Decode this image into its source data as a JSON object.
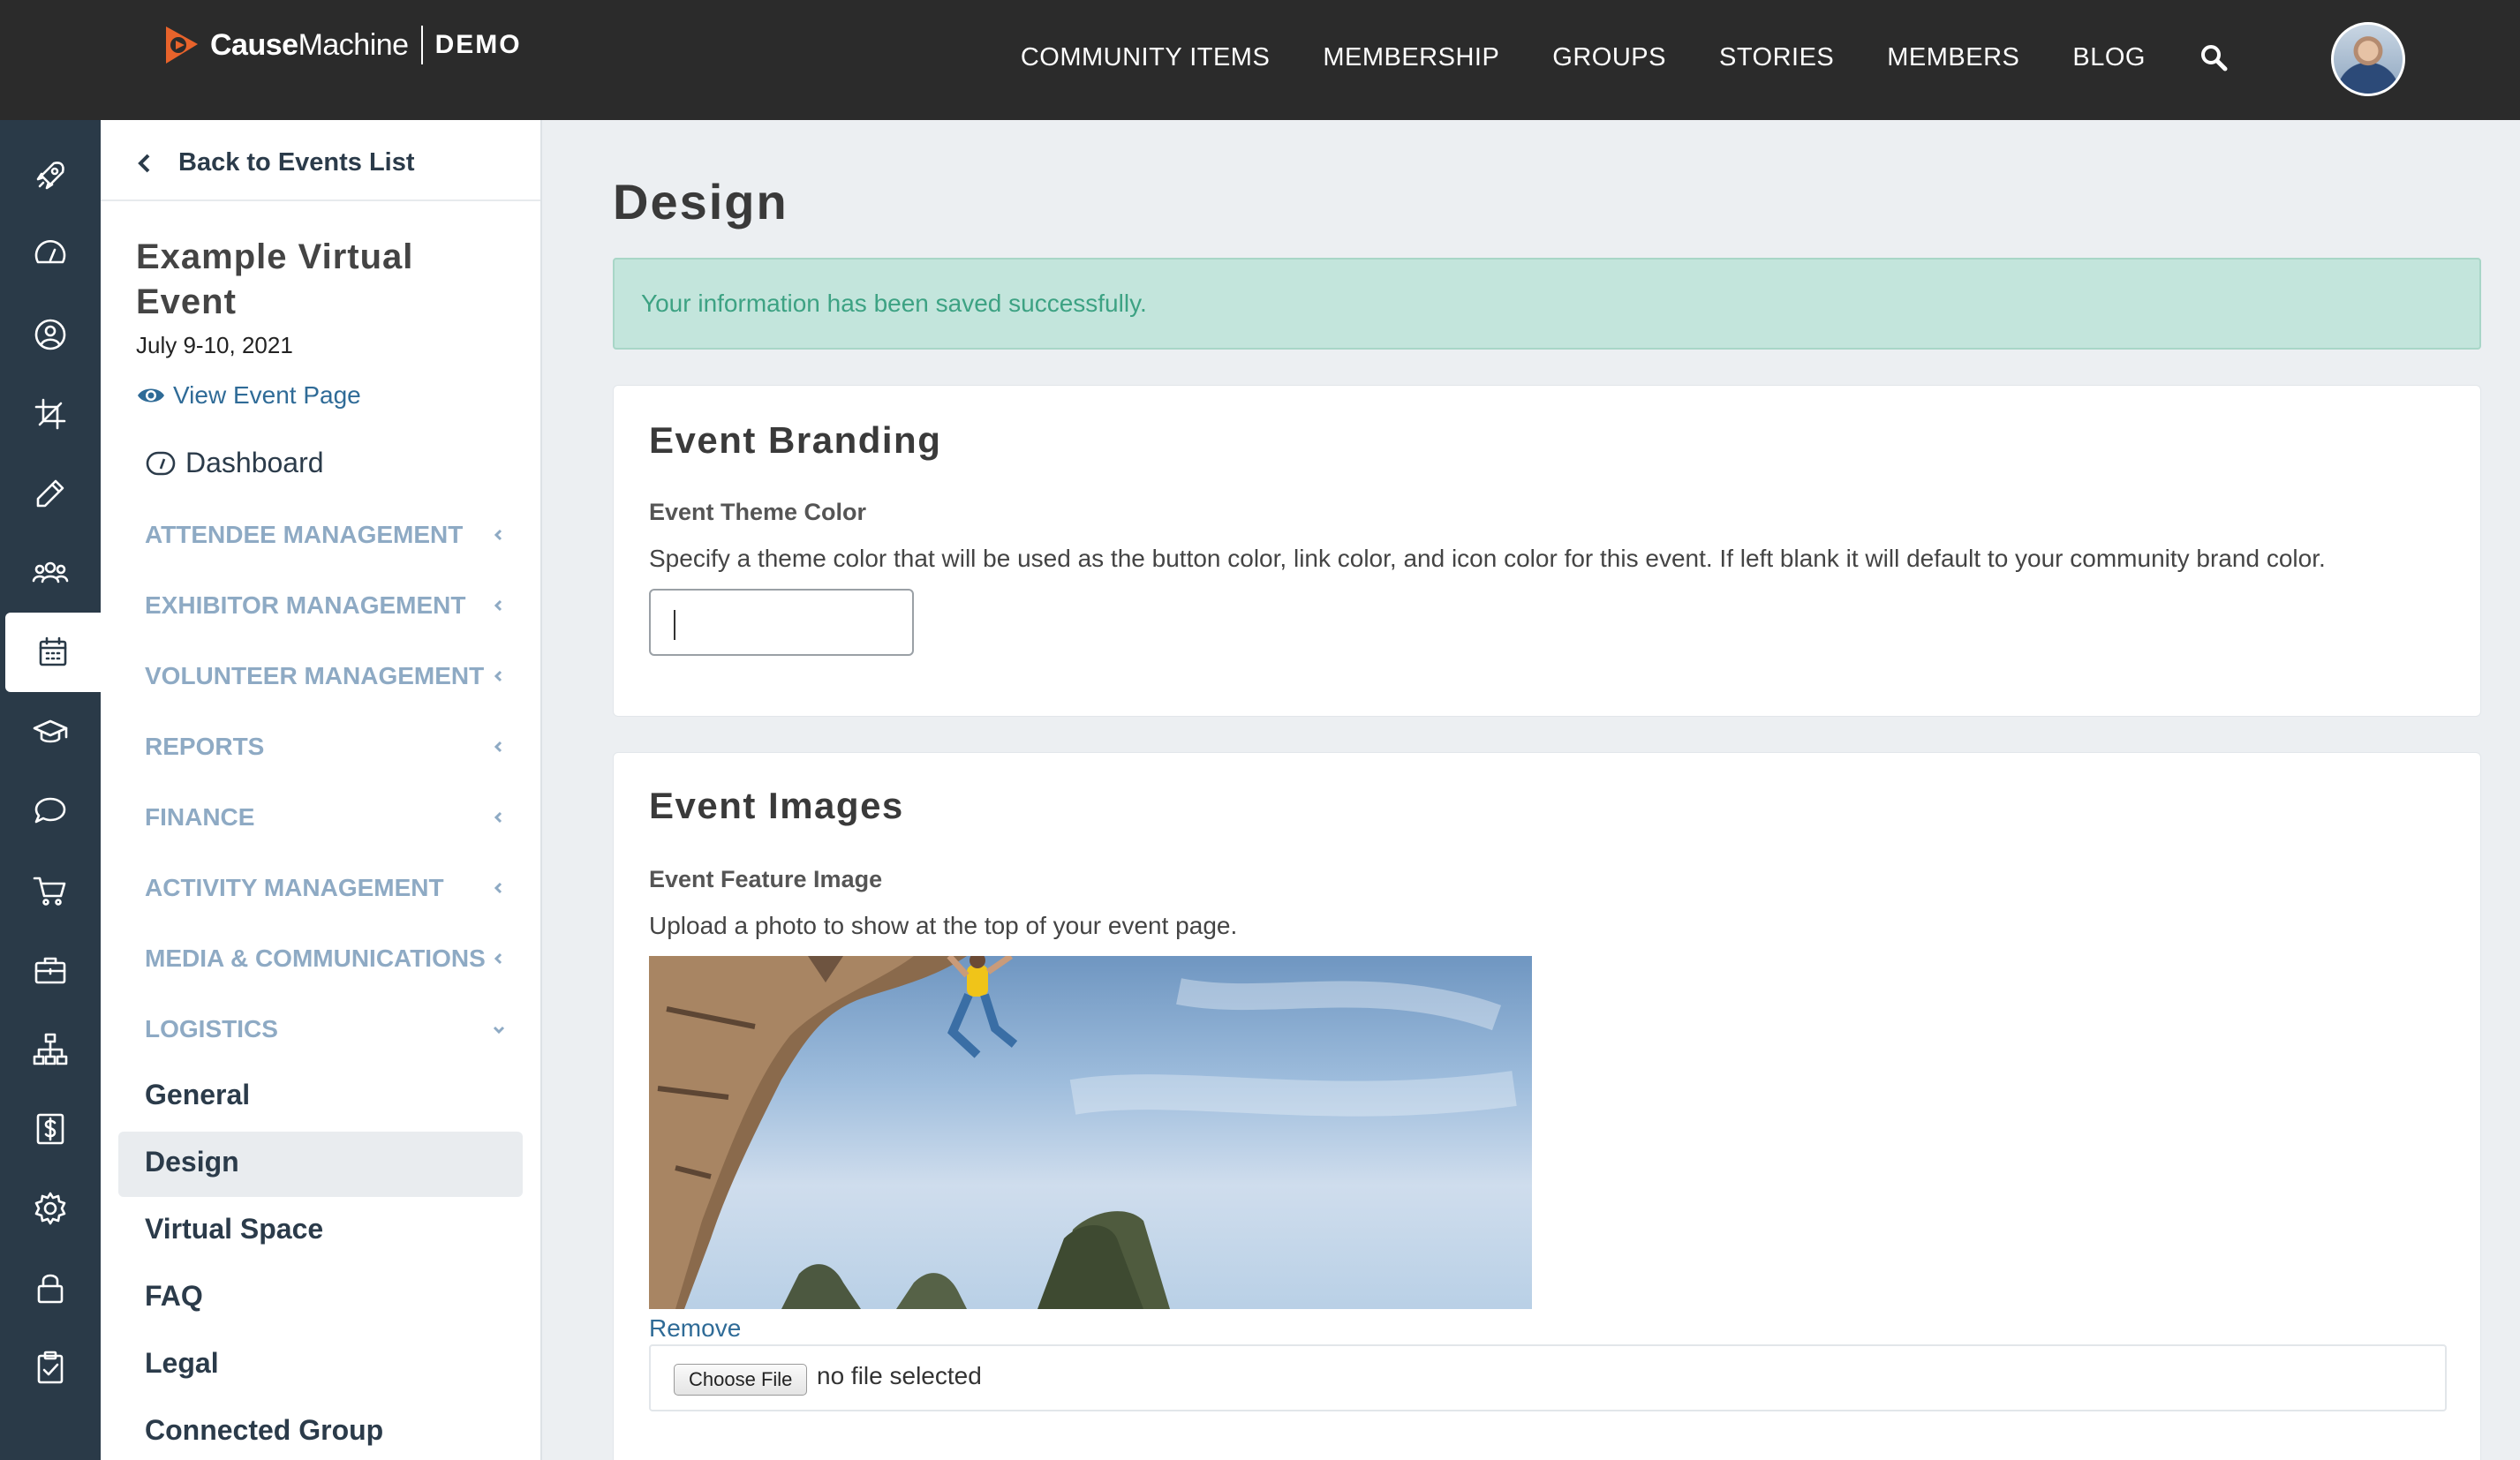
{
  "brand": {
    "name_bold": "Cause",
    "name_light": "Machine",
    "tag": "DEMO",
    "logo_color": "#e8632b"
  },
  "topnav": {
    "items": [
      "COMMUNITY ITEMS",
      "MEMBERSHIP",
      "GROUPS",
      "STORIES",
      "MEMBERS",
      "BLOG"
    ]
  },
  "rail": {
    "icons": [
      "rocket-icon",
      "speedometer-icon",
      "user-circle-icon",
      "crop-icon",
      "pencil-icon",
      "users-icon",
      "calendar-icon",
      "graduation-cap-icon",
      "chat-bubble-icon",
      "cart-icon",
      "briefcase-icon",
      "sitemap-icon",
      "dollar-icon",
      "gear-icon",
      "lock-icon",
      "clipboard-check-icon"
    ],
    "active": "calendar-icon"
  },
  "sidebar": {
    "back_label": "Back to Events List",
    "event_title": "Example Virtual Event",
    "event_date": "July 9-10, 2021",
    "view_page_label": "View Event Page",
    "dashboard_label": "Dashboard",
    "sections": [
      "ATTENDEE MANAGEMENT",
      "EXHIBITOR MANAGEMENT",
      "VOLUNTEER MANAGEMENT",
      "REPORTS",
      "FINANCE",
      "ACTIVITY MANAGEMENT",
      "MEDIA & COMMUNICATIONS",
      "LOGISTICS"
    ],
    "logistics_items": [
      "General",
      "Design",
      "Virtual Space",
      "FAQ",
      "Legal",
      "Connected Group"
    ],
    "active_item": "Design"
  },
  "main": {
    "page_title": "Design",
    "alert_text": "Your information has been saved successfully.",
    "branding": {
      "title": "Event Branding",
      "theme_label": "Event Theme Color",
      "theme_help": "Specify a theme color that will be used as the button color, link color, and icon color for this event. If left blank it will default to your community brand color.",
      "theme_value": ""
    },
    "images": {
      "title": "Event Images",
      "feature_label": "Event Feature Image",
      "feature_help": "Upload a photo to show at the top of your event page.",
      "remove_label": "Remove",
      "choose_file_label": "Choose File",
      "file_status": "no file selected"
    }
  }
}
